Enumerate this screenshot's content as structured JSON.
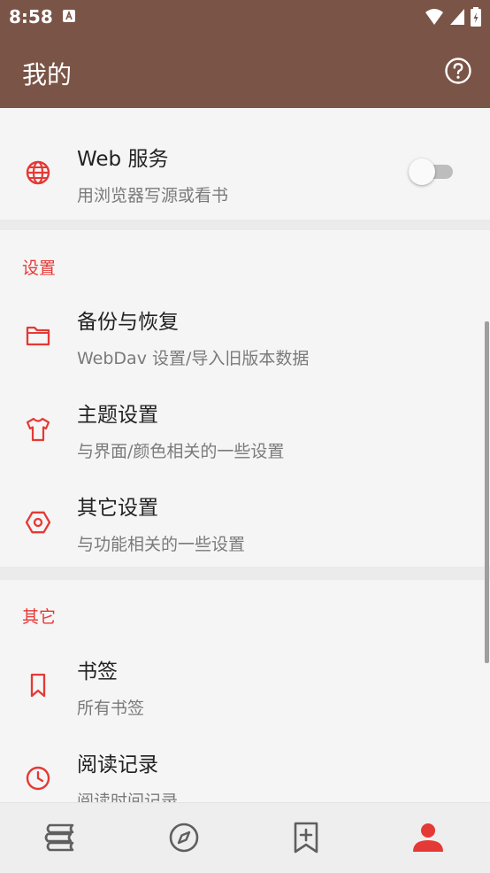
{
  "status_bar": {
    "time": "8:58"
  },
  "toolbar": {
    "title": "我的"
  },
  "web_service": {
    "title": "Web 服务",
    "subtitle": "用浏览器写源或看书",
    "enabled": false
  },
  "settings_section": {
    "header": "设置",
    "items": [
      {
        "title": "备份与恢复",
        "subtitle": "WebDav 设置/导入旧版本数据",
        "icon": "folder-icon"
      },
      {
        "title": "主题设置",
        "subtitle": "与界面/颜色相关的一些设置",
        "icon": "tshirt-icon"
      },
      {
        "title": "其它设置",
        "subtitle": "与功能相关的一些设置",
        "icon": "hexagon-settings-icon"
      }
    ]
  },
  "other_section": {
    "header": "其它",
    "items": [
      {
        "title": "书签",
        "subtitle": "所有书签",
        "icon": "bookmark-icon"
      },
      {
        "title": "阅读记录",
        "subtitle": "阅读时间记录",
        "icon": "clock-icon"
      }
    ]
  },
  "bottom_nav": {
    "items": [
      "bookshelf-icon",
      "compass-icon",
      "bookmark-add-icon",
      "person-icon"
    ],
    "active_index": 3
  },
  "colors": {
    "primary": "#7a5446",
    "accent": "#e53935",
    "inactive_icon": "#5f5f5f"
  }
}
